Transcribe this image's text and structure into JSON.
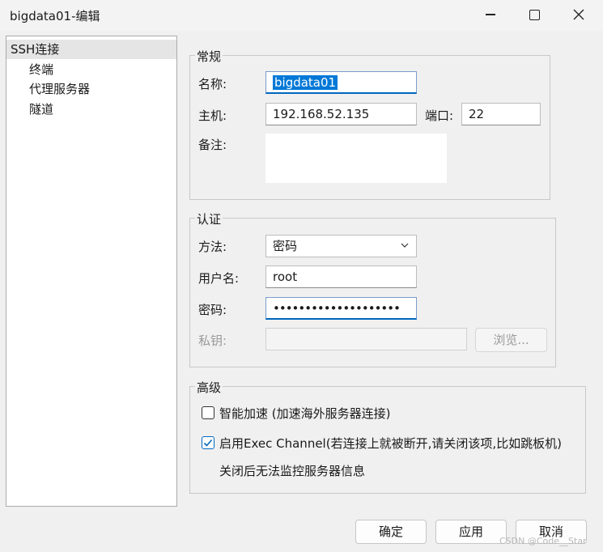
{
  "window": {
    "title": "bigdata01-编辑"
  },
  "tree": {
    "items": [
      {
        "label": "SSH连接",
        "selected": true,
        "level": 0
      },
      {
        "label": "终端",
        "selected": false,
        "level": 1
      },
      {
        "label": "代理服务器",
        "selected": false,
        "level": 1
      },
      {
        "label": "隧道",
        "selected": false,
        "level": 1
      }
    ]
  },
  "general": {
    "legend": "常规",
    "name_label": "名称:",
    "name_value": "bigdata01",
    "host_label": "主机:",
    "host_value": "192.168.52.135",
    "port_label": "端口:",
    "port_value": "22",
    "note_label": "备注:",
    "note_value": ""
  },
  "auth": {
    "legend": "认证",
    "method_label": "方法:",
    "method_value": "密码",
    "user_label": "用户名:",
    "user_value": "root",
    "password_label": "密码:",
    "password_value": "••••••••••••••••••••",
    "key_label": "私钥:",
    "key_value": "",
    "browse_label": "浏览..."
  },
  "advanced": {
    "legend": "高级",
    "smart_accel_label": "智能加速 (加速海外服务器连接)",
    "smart_accel_checked": false,
    "exec_channel_label": "启用Exec Channel(若连接上就被断开,请关闭该项,比如跳板机)",
    "exec_channel_checked": true,
    "exec_channel_note": "关闭后无法监控服务器信息"
  },
  "footer": {
    "ok_label": "确定",
    "apply_label": "应用",
    "cancel_label": "取消"
  },
  "watermark": "CSDN @Code__Star",
  "colors": {
    "accent": "#0067c0",
    "selection": "#0078d7"
  }
}
